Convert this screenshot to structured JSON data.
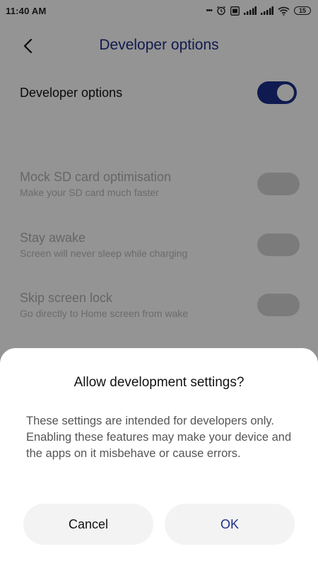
{
  "status_bar": {
    "time": "11:40 AM",
    "dots": "•••",
    "battery": "15"
  },
  "header": {
    "title": "Developer options"
  },
  "settings": {
    "master_label": "Developer options",
    "master_on": true,
    "items": [
      {
        "title": "Mock SD card optimisation",
        "subtitle": "Make your SD card much faster"
      },
      {
        "title": "Stay awake",
        "subtitle": "Screen will never sleep while charging"
      },
      {
        "title": "Skip screen lock",
        "subtitle": "Go directly to Home screen from wake"
      }
    ]
  },
  "dialog": {
    "title": "Allow development settings?",
    "message": "These settings are intended for developers only. Enabling these features may make your device and the apps on it misbehave or cause errors.",
    "cancel_label": "Cancel",
    "ok_label": "OK"
  },
  "colors": {
    "accent": "#1b2f8a",
    "title_blue": "#1f2f86"
  },
  "icons": {
    "back": "chevron-left-icon",
    "alarm": "alarm-icon",
    "signal": "signal-icon",
    "wifi": "wifi-icon",
    "battery": "battery-icon"
  }
}
